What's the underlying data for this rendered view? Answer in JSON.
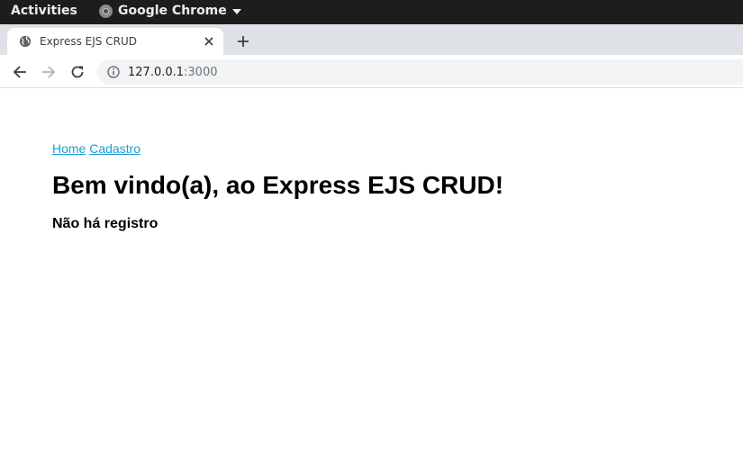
{
  "system_bar": {
    "activities_label": "Activities",
    "app_name": "Google Chrome",
    "app_icon": "chrome-icon"
  },
  "browser": {
    "tab": {
      "title": "Express EJS CRUD",
      "favicon": "globe-icon"
    },
    "address": {
      "host": "127.0.0.1",
      "port": ":3000"
    }
  },
  "page": {
    "nav": [
      {
        "label": "Home"
      },
      {
        "label": "Cadastro"
      }
    ],
    "heading": "Bem vindo(a), ao Express EJS CRUD!",
    "empty_message": "Não há registro"
  },
  "colors": {
    "link": "#1a9cd8",
    "topbar": "#1d1d1d",
    "tabstrip": "#dee1e6"
  }
}
